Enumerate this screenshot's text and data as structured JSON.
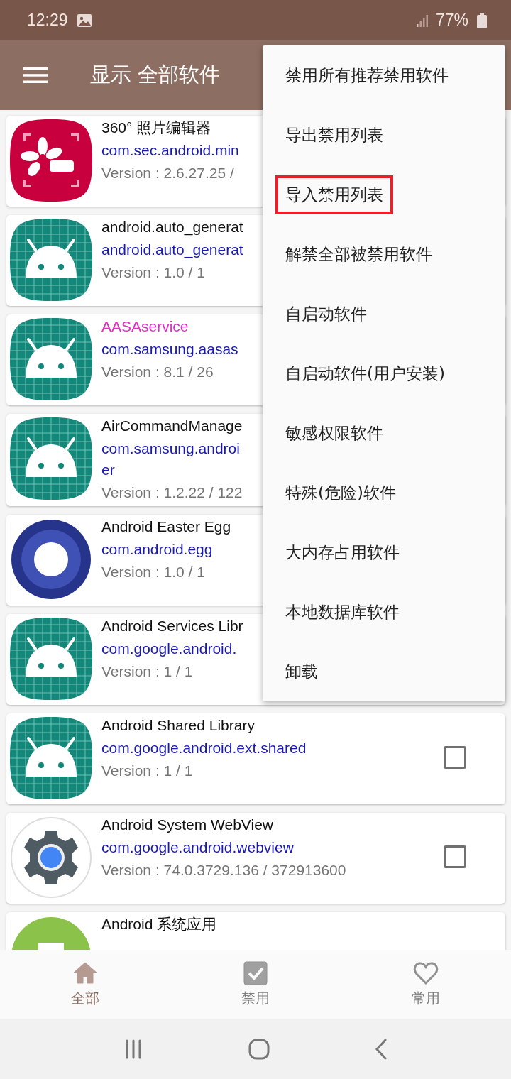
{
  "status_bar": {
    "time": "12:29",
    "battery": "77%"
  },
  "toolbar": {
    "title": "显示 全部软件"
  },
  "apps": [
    {
      "name": "360° 照片编辑器",
      "color": "#111111",
      "kind": "photo",
      "package": [
        "com.sec.android.min"
      ],
      "version": "Version : 2.6.27.25 /"
    },
    {
      "name": "android.auto_generat",
      "color": "#111111",
      "kind": "android",
      "package": [
        "android.auto_generat"
      ],
      "version": "Version : 1.0 / 1"
    },
    {
      "name": "AASAservice",
      "color": "#e231c2",
      "kind": "android",
      "package": [
        "com.samsung.aasas"
      ],
      "version": "Version : 8.1 / 26"
    },
    {
      "name": "AirCommandManage",
      "color": "#111111",
      "kind": "android",
      "package": [
        "com.samsung.androi",
        "er"
      ],
      "version": "Version : 1.2.22 / 122"
    },
    {
      "name": "Android Easter Egg",
      "color": "#111111",
      "kind": "ring",
      "package": [
        "com.android.egg"
      ],
      "version": "Version : 1.0 / 1"
    },
    {
      "name": "Android Services Libr",
      "color": "#111111",
      "kind": "android",
      "package": [
        "com.google.android."
      ],
      "version": "Version : 1 / 1"
    },
    {
      "name": "Android Shared Library",
      "color": "#111111",
      "kind": "android",
      "package": [
        "com.google.android.ext.shared"
      ],
      "version": "Version : 1 / 1",
      "checked": false
    },
    {
      "name": "Android System WebView",
      "color": "#111111",
      "kind": "gear",
      "package": [
        "com.google.android.webview"
      ],
      "version": "Version : 74.0.3729.136 / 372913600",
      "checked": false
    },
    {
      "name": "Android 系统应用",
      "color": "#111111",
      "kind": "green"
    }
  ],
  "menu": {
    "items": [
      {
        "label": "禁用所有推荐禁用软件",
        "highlighted": false
      },
      {
        "label": "导出禁用列表",
        "highlighted": false
      },
      {
        "label": "导入禁用列表",
        "highlighted": true
      },
      {
        "label": "解禁全部被禁用软件",
        "highlighted": false
      },
      {
        "label": "自启动软件",
        "highlighted": false
      },
      {
        "label": "自启动软件(用户安装)",
        "highlighted": false
      },
      {
        "label": "敏感权限软件",
        "highlighted": false
      },
      {
        "label": "特殊(危险)软件",
        "highlighted": false
      },
      {
        "label": "大内存占用软件",
        "highlighted": false
      },
      {
        "label": "本地数据库软件",
        "highlighted": false
      },
      {
        "label": "卸载",
        "highlighted": false
      }
    ]
  },
  "bottom_nav": [
    {
      "label": "全部",
      "kind": "home",
      "selected": true
    },
    {
      "label": "禁用",
      "kind": "check",
      "selected": false
    },
    {
      "label": "常用",
      "kind": "heart",
      "selected": false
    }
  ]
}
